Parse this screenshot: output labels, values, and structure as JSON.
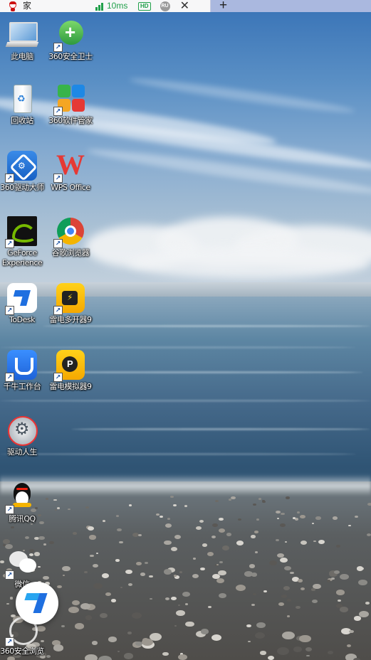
{
  "tab": {
    "title": "家",
    "latency": "10ms",
    "quality_badge": "HD",
    "user_badge": "RU",
    "close_glyph": "✕",
    "new_tab_glyph": "+"
  },
  "desktop": {
    "icons_left": [
      {
        "label": "此电脑",
        "icon": "computer-icon"
      },
      {
        "label": "回收站",
        "icon": "recycle-bin-icon"
      },
      {
        "label": "360驱动大师",
        "icon": "360-driver-master-icon"
      },
      {
        "label": "GeForce\nExperience",
        "icon": "geforce-experience-icon"
      },
      {
        "label": "ToDesk",
        "icon": "todesk-icon"
      },
      {
        "label": "千牛工作台",
        "icon": "qianniu-icon"
      },
      {
        "label": "驱动人生",
        "icon": "driver-life-icon"
      },
      {
        "label": "腾讯QQ",
        "icon": "qq-icon"
      },
      {
        "label": "微信",
        "icon": "wechat-icon"
      },
      {
        "label": "360安全浏览",
        "icon": "360-browser-icon"
      }
    ],
    "icons_right": [
      {
        "label": "360安全卫士",
        "icon": "360-security-icon"
      },
      {
        "label": "360软件管家",
        "icon": "360-software-manager-icon"
      },
      {
        "label": "WPS Office",
        "icon": "wps-office-icon"
      },
      {
        "label": "谷歌浏览器",
        "icon": "chrome-icon"
      },
      {
        "label": "雷电多开器9",
        "icon": "ldplayer-multi-icon"
      },
      {
        "label": "雷电模拟器9",
        "icon": "ldplayer-icon"
      }
    ]
  },
  "colors": {
    "tabbar": "#aab8df",
    "latency_green": "#21a04a"
  }
}
